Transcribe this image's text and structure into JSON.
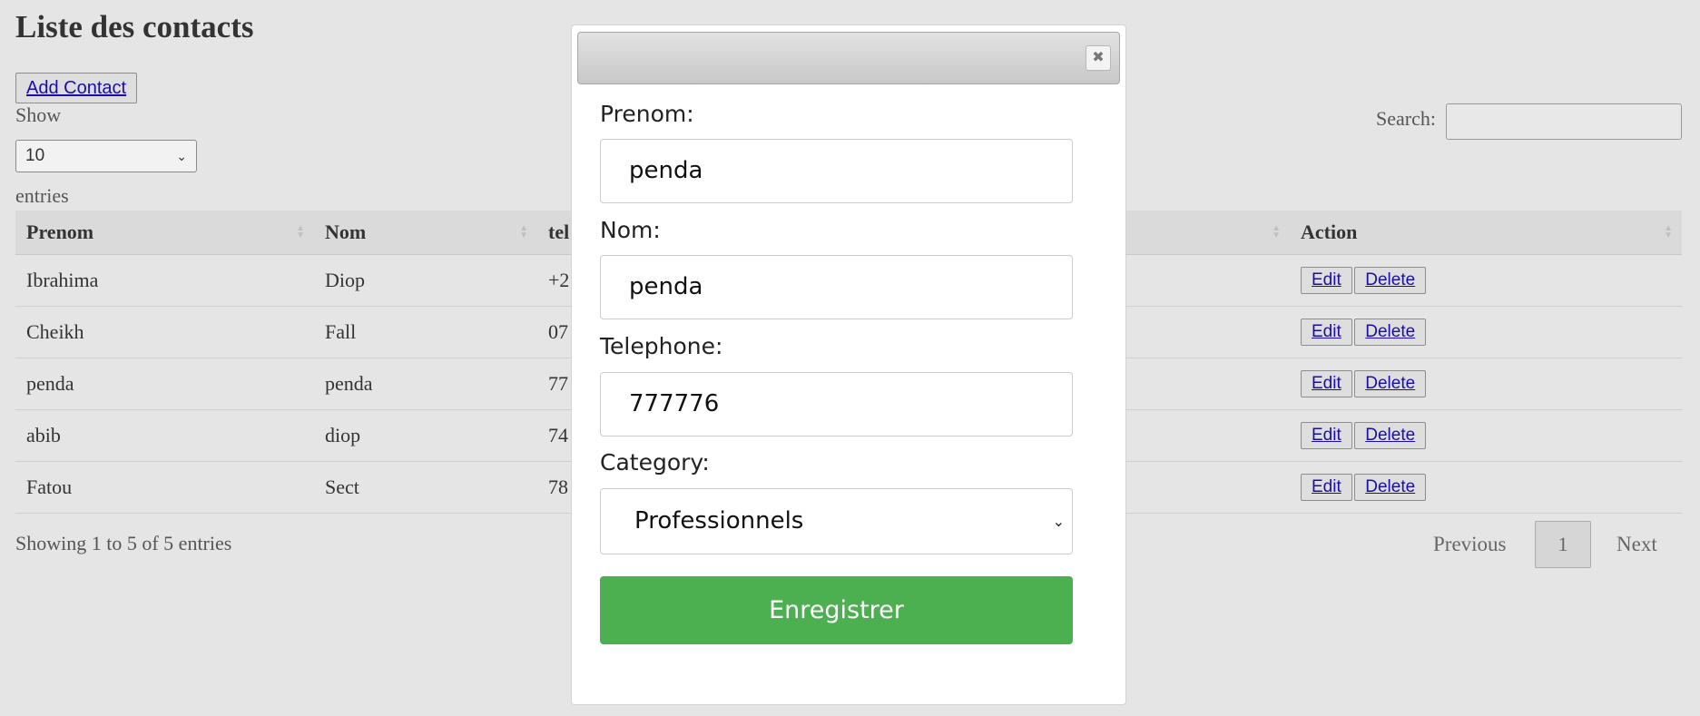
{
  "page": {
    "title": "Liste des contacts",
    "add_button": "Add Contact",
    "show_label": "Show",
    "length_value": "10",
    "entries_label": "entries",
    "search_label": "Search:",
    "search_value": ""
  },
  "table": {
    "columns": [
      "Prenom",
      "Nom",
      "tel",
      "",
      "Action"
    ],
    "rows": [
      {
        "prenom": "Ibrahima",
        "nom": "Diop",
        "tel": "+2"
      },
      {
        "prenom": "Cheikh",
        "nom": "Fall",
        "tel": "07"
      },
      {
        "prenom": "penda",
        "nom": "penda",
        "tel": "77"
      },
      {
        "prenom": "abib",
        "nom": "diop",
        "tel": "74"
      },
      {
        "prenom": "Fatou",
        "nom": "Sect",
        "tel": "78"
      }
    ],
    "edit_label": "Edit",
    "delete_label": "Delete"
  },
  "footer": {
    "info": "Showing 1 to 5 of 5 entries",
    "previous": "Previous",
    "page": "1",
    "next": "Next"
  },
  "modal": {
    "close_symbol": "✖",
    "prenom_label": "Prenom:",
    "prenom_value": "penda",
    "nom_label": "Nom:",
    "nom_value": "penda",
    "telephone_label": "Telephone:",
    "telephone_value": "777776",
    "category_label": "Category:",
    "category_value": "Professionnels",
    "submit_label": "Enregistrer"
  },
  "colors": {
    "background": "#e5e5e5",
    "link": "#1a0dab",
    "submit": "#4caf50"
  }
}
